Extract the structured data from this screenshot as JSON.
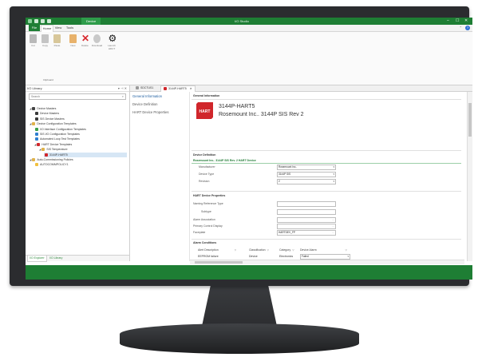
{
  "window": {
    "app_title": "I/O Studio",
    "context_tab": "Device",
    "win_buttons": [
      "–",
      "☐",
      "✕"
    ]
  },
  "ribbon": {
    "tabs": [
      "File",
      "Home",
      "View",
      "Tools"
    ],
    "active_tab": "Home",
    "buttons": [
      {
        "label": "Cut",
        "icon": "scissors-icon",
        "color": "#b9b9b9"
      },
      {
        "label": "Copy",
        "icon": "copy-icon",
        "color": "#c4c4c4"
      },
      {
        "label": "Paste",
        "icon": "paste-icon",
        "color": "#d8c79a"
      },
      {
        "label": "New",
        "icon": "new-document-icon",
        "color": "#e8b26b"
      },
      {
        "label": "Delete",
        "icon": "delete-icon",
        "color": "#d7262b"
      },
      {
        "label": "Download",
        "icon": "download-icon",
        "color": "#c9c9c9"
      },
      {
        "label": "Launch HDCT",
        "icon": "gear-icon",
        "color": "#111111"
      }
    ],
    "group_label": "Clipboard"
  },
  "left_panel": {
    "title": "I/O Library",
    "search_placeholder": "Search",
    "tree": [
      {
        "label": "Device Masters",
        "indent": 0,
        "tri": "◢",
        "icon_color": "#444444"
      },
      {
        "label": "Device Masters",
        "indent": 1,
        "tri": "",
        "icon_color": "#3a3a3a"
      },
      {
        "label": "SIS Device Masters",
        "indent": 1,
        "tri": "",
        "icon_color": "#3a3a3a"
      },
      {
        "label": "Device Configuration Templates",
        "indent": 0,
        "tri": "◢",
        "icon_color": "#e0b24a"
      },
      {
        "label": "I/O Interface Configuration Templates",
        "indent": 1,
        "tri": "",
        "icon_color": "#3aa04a"
      },
      {
        "label": "SIS I/O Configuration Templates",
        "indent": 1,
        "tri": "",
        "icon_color": "#2f7fd0"
      },
      {
        "label": "Automated Loop Test Templates",
        "indent": 1,
        "tri": "",
        "icon_color": "#2f7fd0"
      },
      {
        "label": "HART Device Templates",
        "indent": 1,
        "tri": "◢",
        "icon_color": "#d0262b"
      },
      {
        "label": "SIS Temperature",
        "indent": 2,
        "tri": "◢",
        "icon_color": "#e0b24a"
      },
      {
        "label": "3144P-HART5",
        "indent": 3,
        "tri": "",
        "icon_color": "#d0262b",
        "selected": true
      },
      {
        "label": "Auto-Commissioning Policies",
        "indent": 0,
        "tri": "◢",
        "icon_color": "#e0b24a"
      },
      {
        "label": "AUTOCOMMPOLICY1",
        "indent": 1,
        "tri": "",
        "icon_color": "#f0c040"
      }
    ],
    "bottom_tabs": [
      "I/O Explorer",
      "I/O Library"
    ]
  },
  "doc_tabs": [
    {
      "label": "SDCTUS1",
      "icon_color": "#9a9a9a"
    },
    {
      "label": "3144P-HART5",
      "icon_color": "#d0262b",
      "close": "✕"
    }
  ],
  "nav": [
    "General Information",
    "Device Definition",
    "HART Device Properties"
  ],
  "general": {
    "heading": "General Information",
    "logo_text": "HART",
    "device_name": "3144P-HART5",
    "device_sub": "Rosemount Inc.. 3144P SIS Rev 2"
  },
  "definition": {
    "heading": "Device Definition",
    "green_text": "Rosemount Inc.. 3144P SIS Rev. 2 HART Device",
    "fields": [
      {
        "label": "Manufacturer",
        "value": "Rosemount Inc.."
      },
      {
        "label": "Device Type",
        "value": "3144P SIS"
      },
      {
        "label": "Revision",
        "value": "2"
      }
    ]
  },
  "hart_props": {
    "heading": "HART Device Properties",
    "fields": [
      {
        "label": "Naming Reference Type",
        "value": ""
      },
      {
        "label": "Subtype",
        "value": ""
      },
      {
        "label": "Alarm Association",
        "value": ""
      },
      {
        "label": "Primary Control Display",
        "value": ""
      },
      {
        "label": "Faceplate",
        "value": "HARTDEV_FP"
      }
    ]
  },
  "alarms": {
    "heading": "Alarm Conditions",
    "columns": [
      "Alert Description",
      "Classification",
      "Category",
      "Device Alarm"
    ],
    "rows": [
      {
        "desc": "EEPROM failure",
        "class": "Device",
        "category": "Electronics",
        "alarm": "Failed"
      }
    ]
  }
}
